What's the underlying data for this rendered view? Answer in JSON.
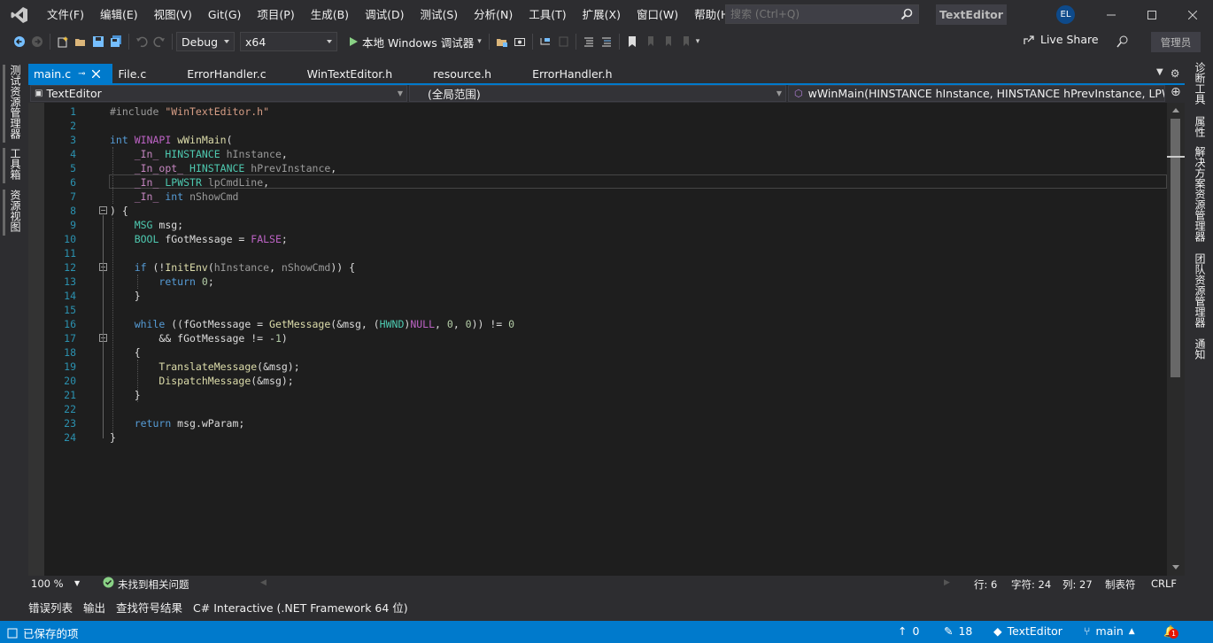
{
  "menu": [
    "文件(F)",
    "编辑(E)",
    "视图(V)",
    "Git(G)",
    "项目(P)",
    "生成(B)",
    "调试(D)",
    "测试(S)",
    "分析(N)",
    "工具(T)",
    "扩展(X)",
    "窗口(W)",
    "帮助(H)"
  ],
  "search": {
    "placeholder": "搜索 (Ctrl+Q)"
  },
  "solution_name": "TextEditor",
  "user_initials": "EL",
  "toolbar": {
    "config": "Debug",
    "platform": "x64",
    "run_label": "本地 Windows 调试器",
    "live_share": "Live Share",
    "admin": "管理员"
  },
  "left_tabs": [
    "测试资源管理器",
    "工具箱",
    "资源视图"
  ],
  "right_tabs": [
    "诊断工具",
    "属性",
    "解决方案资源管理器",
    "团队资源管理器",
    "通知"
  ],
  "tabs": [
    {
      "label": "main.c",
      "active": true
    },
    {
      "label": "File.c"
    },
    {
      "label": "ErrorHandler.c"
    },
    {
      "label": "WinTextEditor.h"
    },
    {
      "label": "resource.h"
    },
    {
      "label": "ErrorHandler.h"
    }
  ],
  "navbar": {
    "project": "TextEditor",
    "scope": "(全局范围)",
    "member": "wWinMain(HINSTANCE hInstance, HINSTANCE hPrevInstance, LPWSTR lpCmdLine, int nShowCmd)"
  },
  "line_numbers": [
    "1",
    "2",
    "3",
    "4",
    "5",
    "6",
    "7",
    "8",
    "9",
    "10",
    "11",
    "12",
    "13",
    "14",
    "15",
    "16",
    "17",
    "18",
    "19",
    "20",
    "21",
    "22",
    "23",
    "24"
  ],
  "editor_status": {
    "zoom": "100 %",
    "issues": "未找到相关问题",
    "line": "行: 6",
    "char": "字符: 24",
    "col": "列: 27",
    "tabs": "制表符",
    "eol": "CRLF"
  },
  "bottom_tabs": [
    "错误列表",
    "输出",
    "查找符号结果",
    "C# Interactive (.NET Framework 64 位)"
  ],
  "statusbar": {
    "message": "已保存的项",
    "up_count": "0",
    "changes": "18",
    "repo": "TextEditor",
    "branch": "main",
    "notifications": "1"
  },
  "colors": {
    "accent": "#007acc",
    "editor_bg": "#1e1e1e",
    "chrome_bg": "#2d2d30"
  }
}
